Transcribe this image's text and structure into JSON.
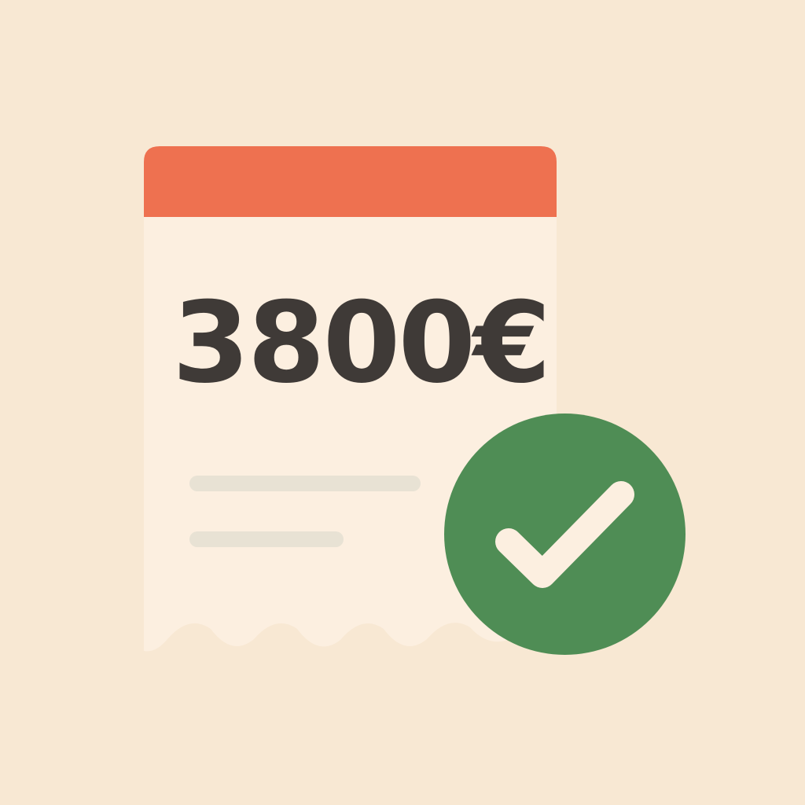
{
  "receipt": {
    "amount": "3800€",
    "header_color": "#EE7150",
    "paper_color": "#FCEFE0"
  },
  "badge": {
    "icon": "checkmark-icon",
    "color": "#4F8D55",
    "mark_color": "#FCEFE0"
  },
  "background_color": "#F8E8D3"
}
